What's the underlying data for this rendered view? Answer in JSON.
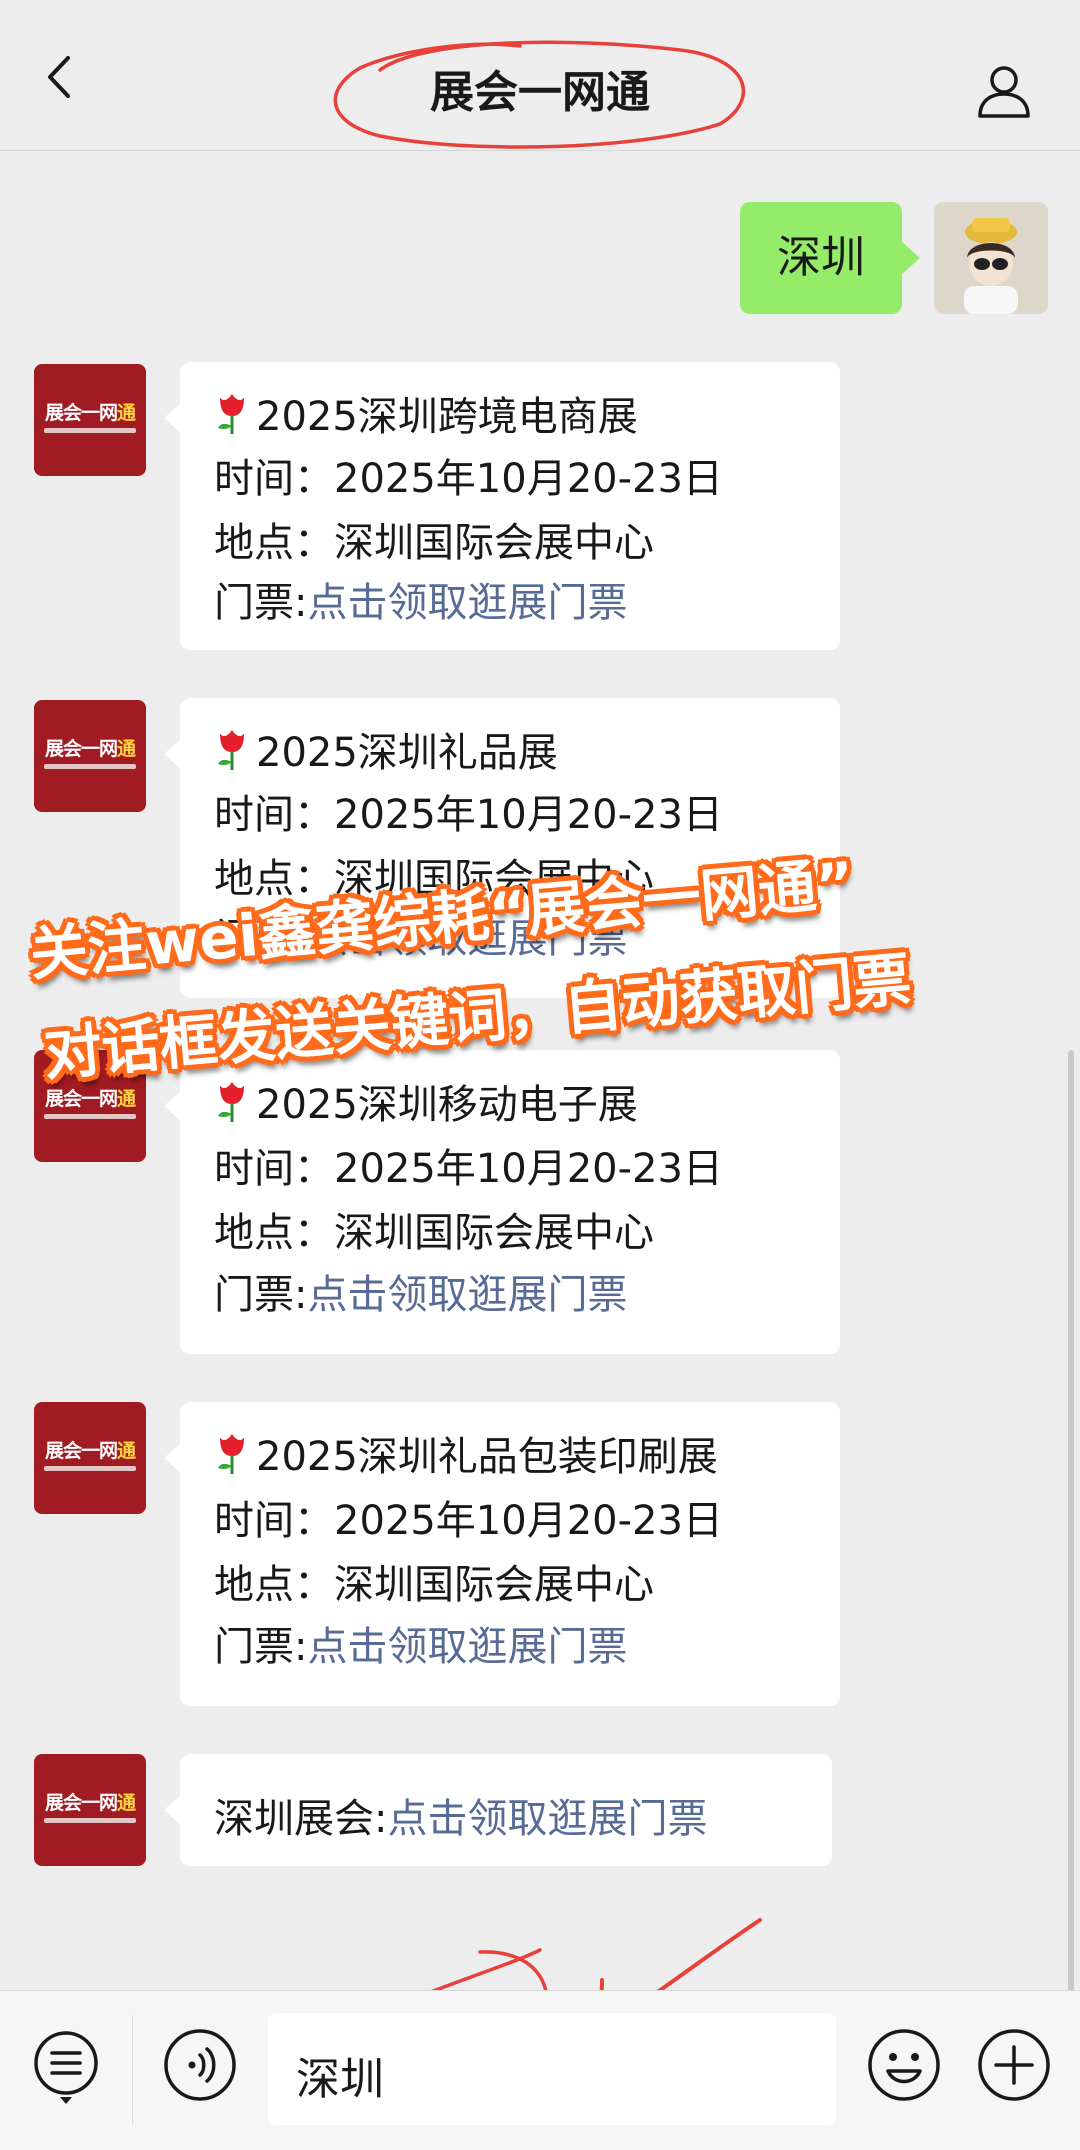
{
  "header": {
    "title": "展会一网通"
  },
  "chat": {
    "outgoing": {
      "text": "深圳"
    },
    "bot_logo": {
      "text_main": "展会一网",
      "text_highlight": "通"
    },
    "cards": [
      {
        "title": "2025深圳跨境电商展",
        "time_label": "时间：",
        "time": "2025年10月20-23日",
        "place_label": "地点：",
        "place": "深圳国际会展中心",
        "ticket_label": "门票:",
        "ticket_link": "点击领取逛展门票"
      },
      {
        "title": "2025深圳礼品展",
        "time_label": "时间：",
        "time": "2025年10月20-23日",
        "place_label": "地点：",
        "place": "深圳国际会展中心",
        "ticket_label": "门票:",
        "ticket_link": "点击领取逛展门票"
      },
      {
        "title": "2025深圳移动电子展",
        "time_label": "时间：",
        "time": "2025年10月20-23日",
        "place_label": "地点：",
        "place": "深圳国际会展中心",
        "ticket_label": "门票:",
        "ticket_link": "点击领取逛展门票"
      },
      {
        "title": "2025深圳礼品包装印刷展",
        "time_label": "时间：",
        "time": "2025年10月20-23日",
        "place_label": "地点：",
        "place": "深圳国际会展中心",
        "ticket_label": "门票:",
        "ticket_link": "点击领取逛展门票"
      }
    ],
    "last": {
      "label": "深圳展会:",
      "link": "点击领取逛展门票"
    }
  },
  "overlay": {
    "line1": "关注wei鑫龚综耗“展会一网通”",
    "line2": "对话框发送关键词，自动获取门票"
  },
  "input": {
    "value": "深圳"
  },
  "colors": {
    "bubble_out": "#95ec69",
    "link": "#576b95",
    "logo_red": "#a11b22",
    "overlay_stroke": "#ff6b1a",
    "annotation_red": "#e8403a"
  },
  "icons": {
    "back": "chevron-left-icon",
    "profile": "person-icon",
    "menu": "menu-list-icon",
    "voice": "voice-icon",
    "emoji": "emoji-icon",
    "plus": "plus-icon",
    "tulip": "tulip-icon"
  }
}
